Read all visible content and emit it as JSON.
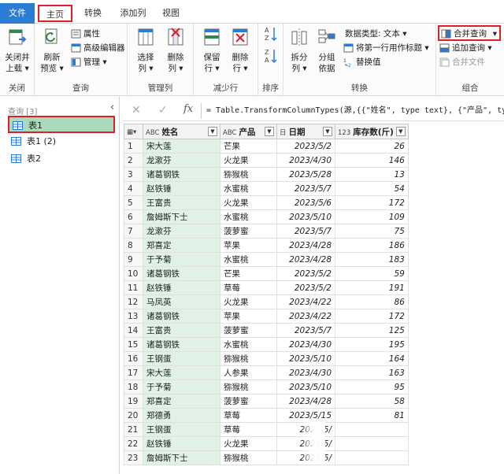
{
  "tabs": [
    {
      "label": "文件"
    },
    {
      "label": "主页"
    },
    {
      "label": "转换"
    },
    {
      "label": "添加列"
    },
    {
      "label": "视图"
    }
  ],
  "ribbon": {
    "groups": {
      "close": "关闭",
      "query": "查询",
      "manage_cols": "管理列",
      "reduce_rows": "减少行",
      "sort": "排序",
      "transform": "转换",
      "combine": "组合"
    },
    "buttons": {
      "close_load_1": "关闭并",
      "close_load_2": "上载 ▾",
      "refresh_1": "刷新",
      "refresh_2": "预览 ▾",
      "properties": "属性",
      "advanced_editor": "高级编辑器",
      "manage": "管理 ▾",
      "choose_cols_1": "选择",
      "choose_cols_2": "列 ▾",
      "remove_cols_1": "删除",
      "remove_cols_2": "列 ▾",
      "keep_rows_1": "保留",
      "keep_rows_2": "行 ▾",
      "remove_rows_1": "删除",
      "remove_rows_2": "行 ▾",
      "split_1": "拆分",
      "split_2": "列 ▾",
      "group_1": "分组",
      "group_2": "依据",
      "data_type": "数据类型: 文本 ▾",
      "first_row_header": "将第一行用作标题 ▾",
      "replace_values": "替换值",
      "merge_queries": "合并查询",
      "append_queries": "追加查询 ▾",
      "combine_files": "合并文件"
    }
  },
  "queries": {
    "header": "查询 [3]",
    "items": [
      {
        "label": "表1"
      },
      {
        "label": "表1 (2)"
      },
      {
        "label": "表2"
      }
    ]
  },
  "formula": {
    "text": "= Table.TransformColumnTypes(源,{{\"姓名\", type text}, {\"产品\", type"
  },
  "table": {
    "columns": [
      {
        "type": "ABC",
        "label": "姓名"
      },
      {
        "type": "ABC",
        "label": "产品"
      },
      {
        "type": "日",
        "label": "日期"
      },
      {
        "type": "123",
        "label": "库存数(斤)"
      }
    ],
    "rows": [
      {
        "n": "1",
        "name": "宋大莲",
        "product": "芒果",
        "date": "2023/5/2",
        "qty": "26"
      },
      {
        "n": "2",
        "name": "龙漱芬",
        "product": "火龙果",
        "date": "2023/4/30",
        "qty": "146"
      },
      {
        "n": "3",
        "name": "诸葛钢铁",
        "product": "猕猴桃",
        "date": "2023/5/28",
        "qty": "13"
      },
      {
        "n": "4",
        "name": "赵铁锤",
        "product": "水蜜桃",
        "date": "2023/5/7",
        "qty": "54"
      },
      {
        "n": "5",
        "name": "王富贵",
        "product": "火龙果",
        "date": "2023/5/6",
        "qty": "172"
      },
      {
        "n": "6",
        "name": "詹姆斯下士",
        "product": "水蜜桃",
        "date": "2023/5/10",
        "qty": "109"
      },
      {
        "n": "7",
        "name": "龙漱芬",
        "product": "菠萝蜜",
        "date": "2023/5/7",
        "qty": "75"
      },
      {
        "n": "8",
        "name": "郑喜定",
        "product": "苹果",
        "date": "2023/4/28",
        "qty": "186"
      },
      {
        "n": "9",
        "name": "于予菊",
        "product": "水蜜桃",
        "date": "2023/4/28",
        "qty": "183"
      },
      {
        "n": "10",
        "name": "诸葛钢铁",
        "product": "芒果",
        "date": "2023/5/2",
        "qty": "59"
      },
      {
        "n": "11",
        "name": "赵铁锤",
        "product": "草莓",
        "date": "2023/5/2",
        "qty": "191"
      },
      {
        "n": "12",
        "name": "马凤英",
        "product": "火龙果",
        "date": "2023/4/22",
        "qty": "86"
      },
      {
        "n": "13",
        "name": "诸葛钢铁",
        "product": "苹果",
        "date": "2023/4/22",
        "qty": "172"
      },
      {
        "n": "14",
        "name": "王富贵",
        "product": "菠萝蜜",
        "date": "2023/5/7",
        "qty": "125"
      },
      {
        "n": "15",
        "name": "诸葛钢铁",
        "product": "水蜜桃",
        "date": "2023/4/30",
        "qty": "195"
      },
      {
        "n": "16",
        "name": "王钢蛋",
        "product": "猕猴桃",
        "date": "2023/5/10",
        "qty": "164"
      },
      {
        "n": "17",
        "name": "宋大莲",
        "product": "人参果",
        "date": "2023/4/30",
        "qty": "163"
      },
      {
        "n": "18",
        "name": "于予菊",
        "product": "猕猴桃",
        "date": "2023/5/10",
        "qty": "95"
      },
      {
        "n": "19",
        "name": "郑喜定",
        "product": "菠萝蜜",
        "date": "2023/4/28",
        "qty": "58"
      },
      {
        "n": "20",
        "name": "郑德勇",
        "product": "草莓",
        "date": "2023/5/15",
        "qty": "81"
      },
      {
        "n": "21",
        "name": "王钢蛋",
        "product": "草莓",
        "date": "2023/5/",
        "qty": ""
      },
      {
        "n": "22",
        "name": "赵铁锤",
        "product": "火龙果",
        "date": "2023/5/",
        "qty": ""
      },
      {
        "n": "23",
        "name": "詹姆斯下士",
        "product": "猕猴桃",
        "date": "2023/5/",
        "qty": ""
      }
    ]
  },
  "colors": {
    "file_tab": "#2b7cd3",
    "highlight": "#e11d2a",
    "selected_query": "#a9dbbb",
    "name_col": "#dff2e5"
  }
}
